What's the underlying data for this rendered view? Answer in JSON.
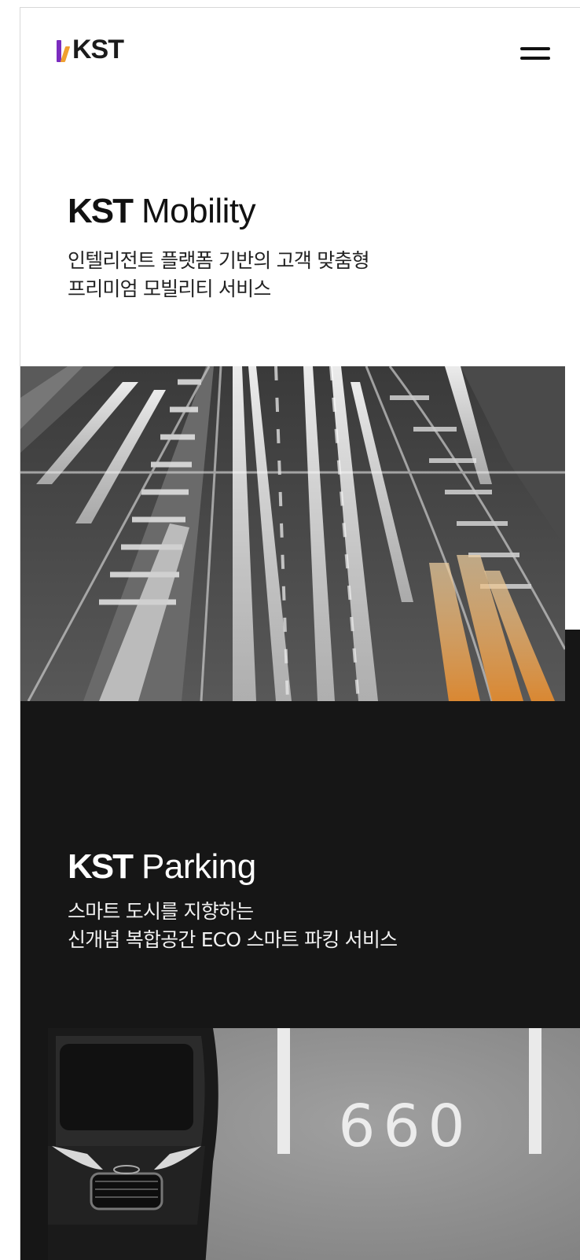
{
  "header": {
    "logo_text": "KST",
    "menu_label": "menu"
  },
  "mobility": {
    "title_brand": "KST",
    "title_word": "Mobility",
    "desc_line1": "인텔리전트 플랫폼 기반의 고객 맞춤형",
    "desc_line2": "프리미엄 모빌리티 서비스",
    "photo_icon": "highway-light-trails-photo"
  },
  "parking": {
    "title_brand": "KST",
    "title_word": "Parking",
    "desc_line1": "스마트 도시를 지향하는",
    "desc_line2": "신개념 복합공간 ECO 스마트 파킹 서비스",
    "photo_icon": "parking-lot-car-photo",
    "spot_number": "660"
  },
  "colors": {
    "brand_purple": "#7b2cbf",
    "brand_orange": "#f0a030",
    "dark_section": "#161616"
  }
}
